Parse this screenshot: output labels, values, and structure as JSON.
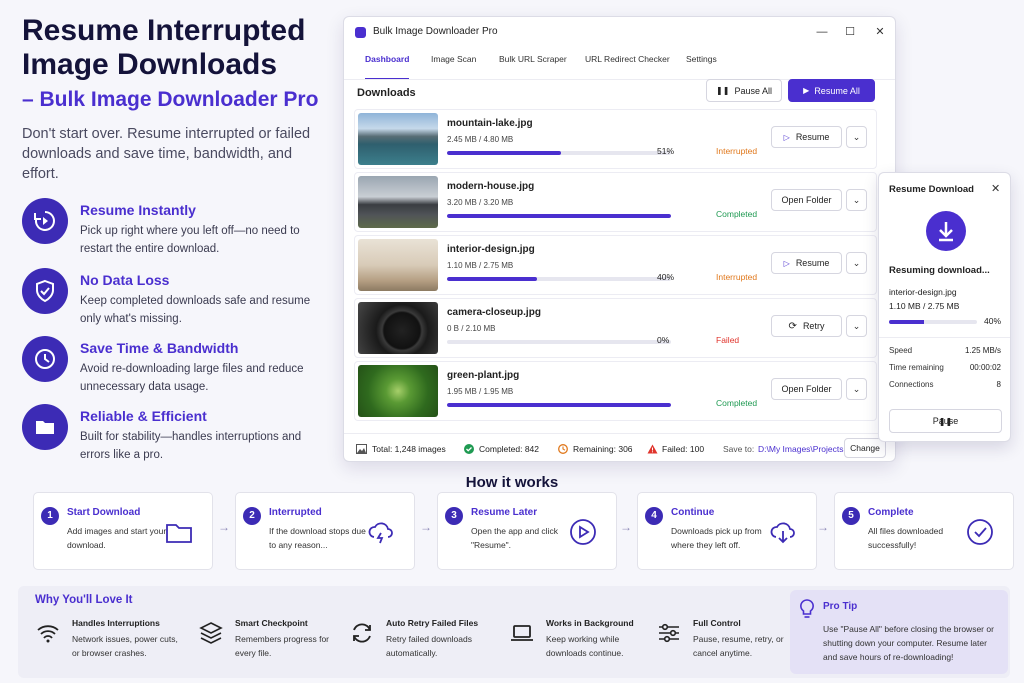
{
  "hero": {
    "title": "Resume Interrupted Image Downloads",
    "subtitle": "– Bulk Image Downloader Pro",
    "description": "Don't start over. Resume interrupted or failed downloads and save time, bandwidth, and effort."
  },
  "features": [
    {
      "title": "Resume Instantly",
      "desc": "Pick up right where you left off—no need to restart the entire download.",
      "icon": "resume-cycle-icon"
    },
    {
      "title": "No Data Loss",
      "desc": "Keep completed downloads safe and resume only what's missing.",
      "icon": "shield-check-icon"
    },
    {
      "title": "Save Time & Bandwidth",
      "desc": "Avoid re-downloading large files and reduce unnecessary data usage.",
      "icon": "clock-icon"
    },
    {
      "title": "Reliable & Efficient",
      "desc": "Built for stability—handles interruptions and errors like a pro.",
      "icon": "folder-icon"
    }
  ],
  "app": {
    "title": "Bulk Image Downloader Pro",
    "controls": {
      "minimize": "—",
      "maximize": "☐",
      "close": "✕"
    },
    "tabs": [
      "Dashboard",
      "Image Scan",
      "Bulk URL Scraper",
      "URL Redirect Checker",
      "Settings"
    ],
    "active_tab": "Dashboard",
    "downloads_title": "Downloads",
    "pause_all": "Pause All",
    "resume_all": "Resume All",
    "rows": [
      {
        "name": "mountain-lake.jpg",
        "size": "2.45 MB / 4.80 MB",
        "progress": 51,
        "pct": "51%",
        "status": "Interrupted",
        "action": "Resume",
        "chevron": "⌄"
      },
      {
        "name": "modern-house.jpg",
        "size": "3.20 MB / 3.20 MB",
        "progress": 100,
        "pct": "",
        "status": "Completed",
        "action": "Open Folder",
        "chevron": "⌄"
      },
      {
        "name": "interior-design.jpg",
        "size": "1.10 MB / 2.75 MB",
        "progress": 40,
        "pct": "40%",
        "status": "Interrupted",
        "action": "Resume",
        "chevron": "⌄"
      },
      {
        "name": "camera-closeup.jpg",
        "size": "0 B / 2.10 MB",
        "progress": 0,
        "pct": "0%",
        "status": "Failed",
        "action": "Retry",
        "chevron": "⌄"
      },
      {
        "name": "green-plant.jpg",
        "size": "1.95 MB / 1.95 MB",
        "progress": 100,
        "pct": "",
        "status": "Completed",
        "action": "Open Folder",
        "chevron": "⌄"
      }
    ],
    "footer": {
      "total": "Total: 1,248 images",
      "completed": "Completed: 842",
      "remaining": "Remaining: 306",
      "failed": "Failed: 100",
      "save_to_label": "Save to:",
      "save_path": "D:\\My Images\\Projects",
      "change": "Change"
    }
  },
  "popup": {
    "title": "Resume Download",
    "close": "✕",
    "resuming": "Resuming download...",
    "file": "interior-design.jpg",
    "size": "1.10 MB / 2.75 MB",
    "progress": 40,
    "pct": "40%",
    "speed_label": "Speed",
    "speed": "1.25 MB/s",
    "time_label": "Time remaining",
    "time": "00:00:02",
    "conn_label": "Connections",
    "conn": "8",
    "pause": "Pause"
  },
  "how": {
    "title": "How it works",
    "arrow": "→",
    "steps": [
      {
        "num": "1",
        "title": "Start Download",
        "desc": "Add images and start your download."
      },
      {
        "num": "2",
        "title": "Interrupted",
        "desc": "If the download stops due to any reason..."
      },
      {
        "num": "3",
        "title": "Resume Later",
        "desc": "Open the app and click \"Resume\"."
      },
      {
        "num": "4",
        "title": "Continue",
        "desc": "Downloads pick up from where they left off."
      },
      {
        "num": "5",
        "title": "Complete",
        "desc": "All files downloaded successfully!"
      }
    ]
  },
  "why": {
    "title": "Why You'll Love It",
    "items": [
      {
        "title": "Handles Interruptions",
        "desc": "Network issues, power cuts, or browser crashes."
      },
      {
        "title": "Smart Checkpoint",
        "desc": "Remembers progress for every file."
      },
      {
        "title": "Auto Retry Failed Files",
        "desc": "Retry failed downloads automatically."
      },
      {
        "title": "Works in Background",
        "desc": "Keep working while downloads continue."
      },
      {
        "title": "Full Control",
        "desc": "Pause, resume, retry, or cancel anytime."
      }
    ]
  },
  "tip": {
    "title": "Pro Tip",
    "text": "Use \"Pause All\" before closing the browser or shutting down your computer. Resume later and save hours of re-downloading!"
  },
  "colors": {
    "accent": "#4a2fcf",
    "interrupted": "#e0781c",
    "completed": "#1f9a52",
    "failed": "#e0342c"
  }
}
